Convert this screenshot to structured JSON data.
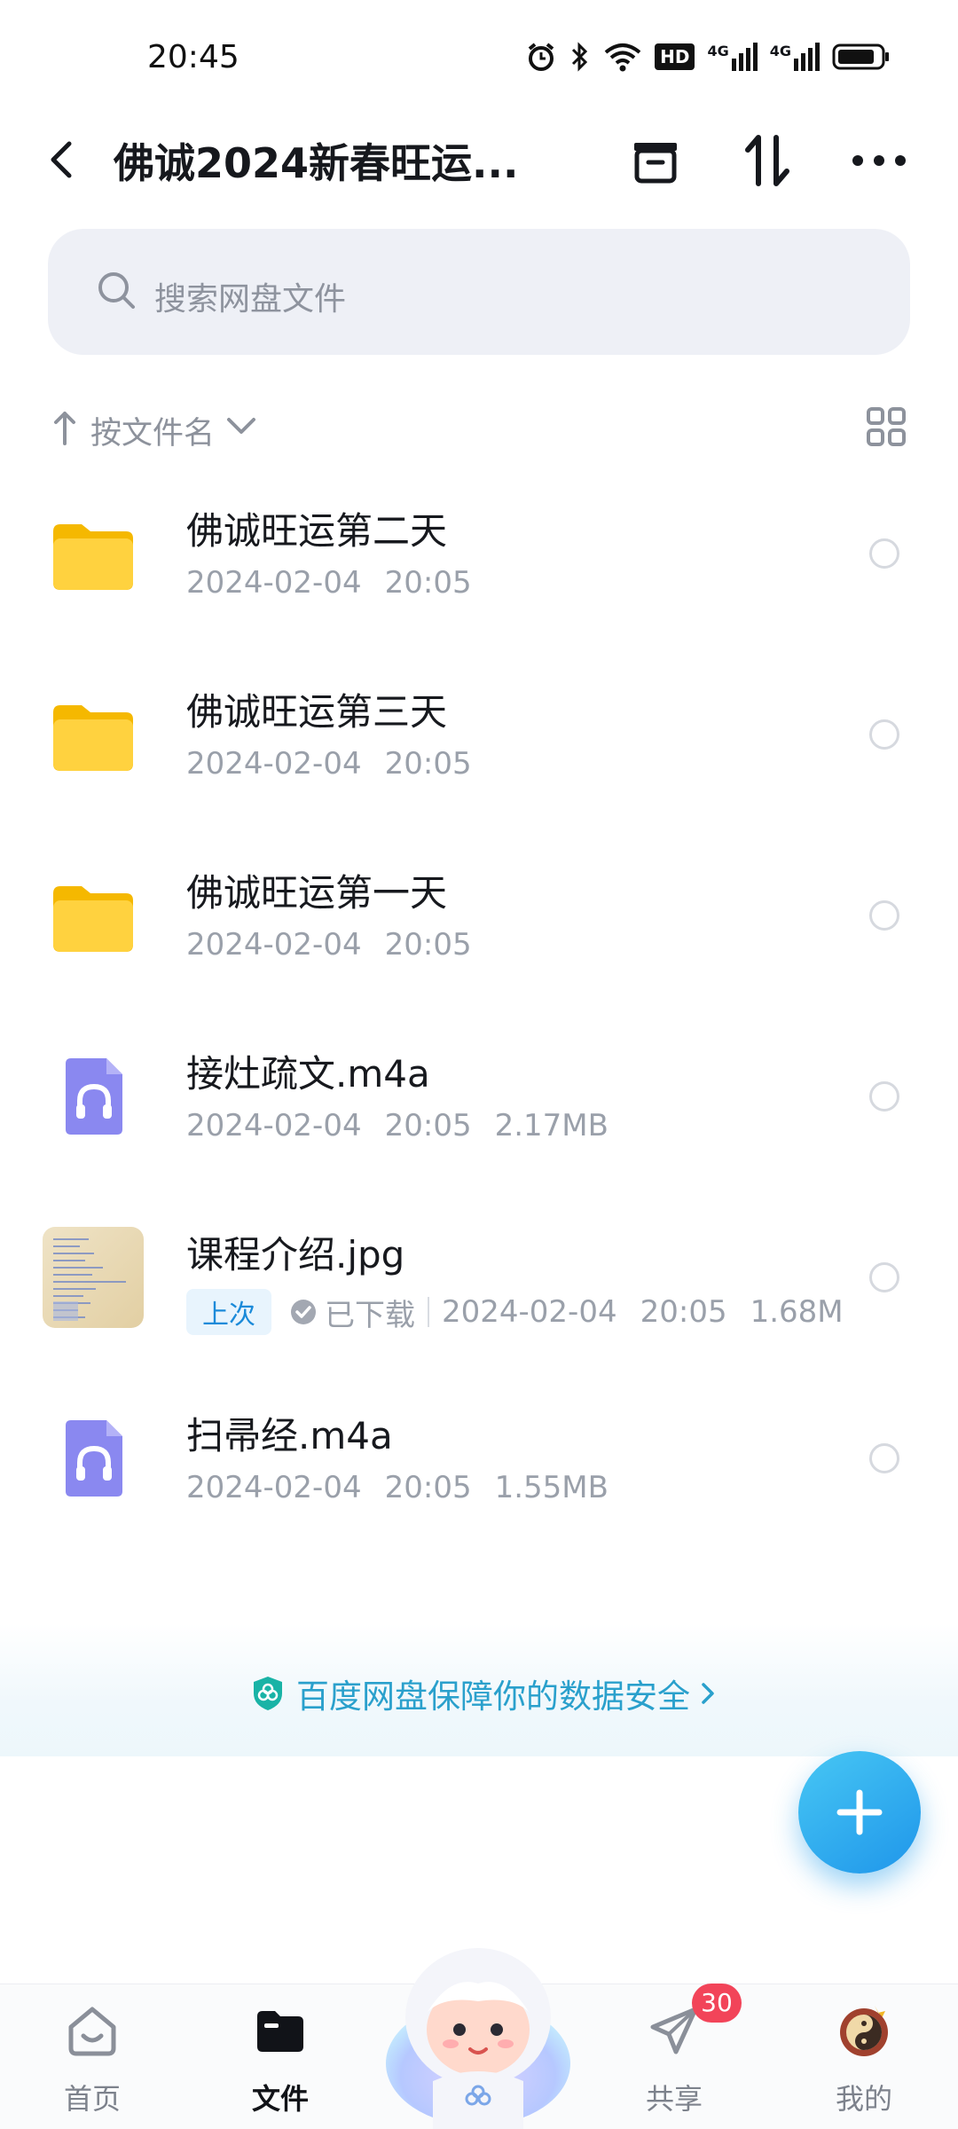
{
  "status_bar": {
    "time": "20:45",
    "icons": [
      "alarm-icon",
      "bluetooth-icon",
      "wifi-icon",
      "hd-icon",
      "signal-4g-icon",
      "signal-4g-icon",
      "battery-icon"
    ],
    "hd_text": "HD",
    "net_1": "4G",
    "net_2": "4G"
  },
  "header": {
    "title": "佛诚2024新春旺运...",
    "actions": [
      "archive-icon",
      "sort-transfer-icon",
      "more-icon"
    ]
  },
  "search": {
    "placeholder": "搜索网盘文件"
  },
  "sort": {
    "label": "按文件名",
    "direction": "ascending"
  },
  "files": [
    {
      "name": "佛诚旺运第二天",
      "type": "folder",
      "date": "2024-02-04",
      "time": "20:05",
      "size": ""
    },
    {
      "name": "佛诚旺运第三天",
      "type": "folder",
      "date": "2024-02-04",
      "time": "20:05",
      "size": ""
    },
    {
      "name": "佛诚旺运第一天",
      "type": "folder",
      "date": "2024-02-04",
      "time": "20:05",
      "size": ""
    },
    {
      "name": "接灶疏文.m4a",
      "type": "audio",
      "date": "2024-02-04",
      "time": "20:05",
      "size": "2.17MB"
    },
    {
      "name": "课程介绍.jpg",
      "type": "image",
      "badge": "上次",
      "status": "已下载",
      "date": "2024-02-04",
      "time": "20:05",
      "size": "1.68M"
    },
    {
      "name": "扫帚经.m4a",
      "type": "audio",
      "date": "2024-02-04",
      "time": "20:05",
      "size": "1.55MB"
    }
  ],
  "security_banner": {
    "text": "百度网盘保障你的数据安全"
  },
  "tab_bar": {
    "tabs": [
      {
        "label": "首页",
        "icon": "home-icon",
        "active": false
      },
      {
        "label": "文件",
        "icon": "folder-icon",
        "active": true
      },
      {
        "label": "共享",
        "icon": "share-icon",
        "active": false,
        "badge": "30"
      },
      {
        "label": "我的",
        "icon": "avatar",
        "active": false
      }
    ]
  },
  "colors": {
    "accent": "#1f96ea",
    "folder": "#ffd23f",
    "audio": "#8a88f0",
    "badge": "#f24459"
  }
}
